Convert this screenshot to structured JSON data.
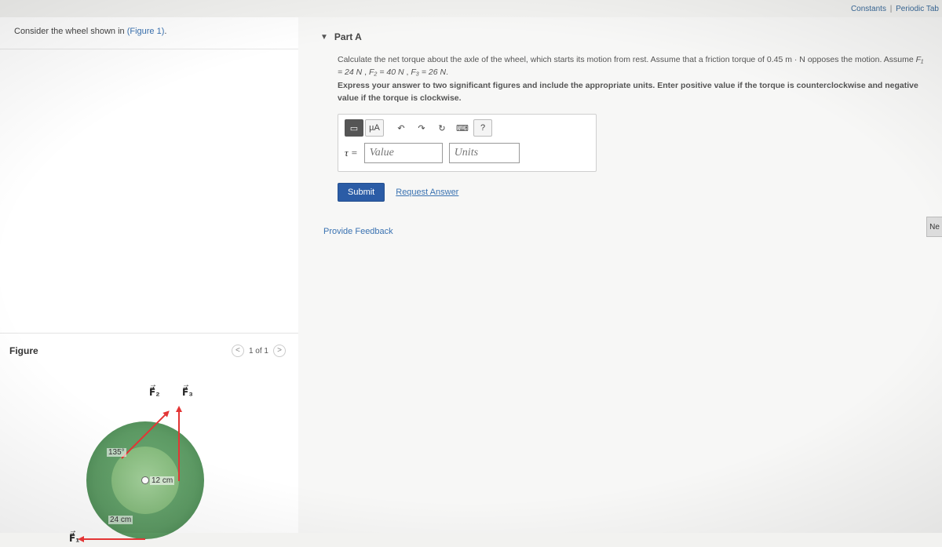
{
  "topLinks": {
    "constants": "Constants",
    "periodic": "Periodic Tab"
  },
  "problem": {
    "intro": "Consider the wheel shown in ",
    "figlink": "(Figure 1)"
  },
  "figure": {
    "title": "Figure",
    "pager": "1 of 1",
    "angle": "135°",
    "innerR": "12 cm",
    "outerR": "24 cm",
    "f1": "F⃗₁",
    "f2": "F⃗₂",
    "f3": "F⃗₃"
  },
  "partA": {
    "title": "Part A",
    "line1_a": "Calculate the net torque about the axle of the wheel, which starts its motion from rest. Assume that a friction torque of 0.45 ",
    "line1_units": "m · N",
    "line1_b": " opposes the motion. Assume ",
    "f1": "F₁ = 24 N",
    "sep1": " , ",
    "f2": "F₂ = 40 N",
    "sep2": " , ",
    "f3": "F₃ = 26 N",
    "period": ".",
    "line2": "Express your answer to two significant figures and include the appropriate units. Enter positive value if the torque is counterclockwise and negative value if the torque is clockwise.",
    "tools": {
      "template": "▭",
      "muA": "µA",
      "undo": "↶",
      "redo": "↷",
      "reset": "↻",
      "keyboard": "⌨",
      "help": "?"
    },
    "tau": "τ =",
    "valuePH": "Value",
    "unitsPH": "Units",
    "submit": "Submit",
    "request": "Request Answer",
    "feedback": "Provide Feedback",
    "next": "Ne"
  }
}
